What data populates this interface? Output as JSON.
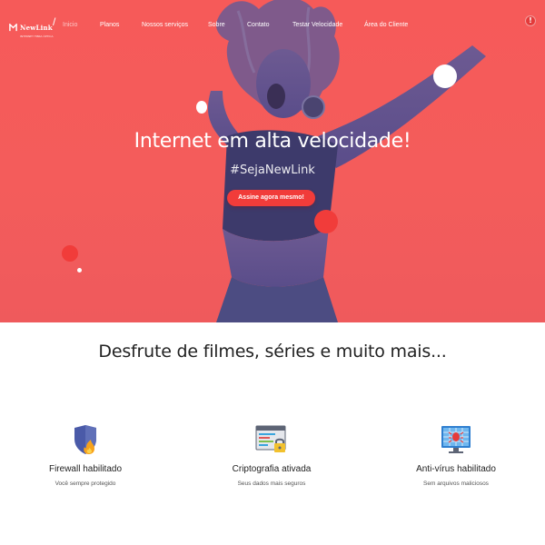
{
  "nav": {
    "logo_text": "NewLink",
    "logo_subtext": "INTERNET FIBRA ÓPTICA",
    "slash": "/",
    "breadcrumb": "Inicio",
    "links": [
      {
        "label": "Planos"
      },
      {
        "label": "Nossos serviços"
      },
      {
        "label": "Sobre"
      },
      {
        "label": "Contato"
      },
      {
        "label": "Testar Velocidade"
      },
      {
        "label": "Área do Cliente"
      }
    ],
    "cta_icon": "!"
  },
  "hero": {
    "title": "Internet em alta velocidade!",
    "tagline": "#SejaNewLink",
    "button_label": "Assine agora mesmo!"
  },
  "section": {
    "title": "Desfrute de filmes, séries e muito mais..."
  },
  "features": [
    {
      "icon": "shield-fire-icon",
      "title": "Firewall habilitado",
      "desc": "Você sempre protegido"
    },
    {
      "icon": "encrypted-browser-icon",
      "title": "Criptografia ativada",
      "desc": "Seus dados mais seguros"
    },
    {
      "icon": "antivirus-monitor-icon",
      "title": "Anti-vírus habilitado",
      "desc": "Sem arquivos maliciosos"
    }
  ],
  "colors": {
    "hero_bg": "#f45c5b",
    "figure_tone": "#4c4c82",
    "button": "#f13c3a",
    "heading": "#222222"
  }
}
